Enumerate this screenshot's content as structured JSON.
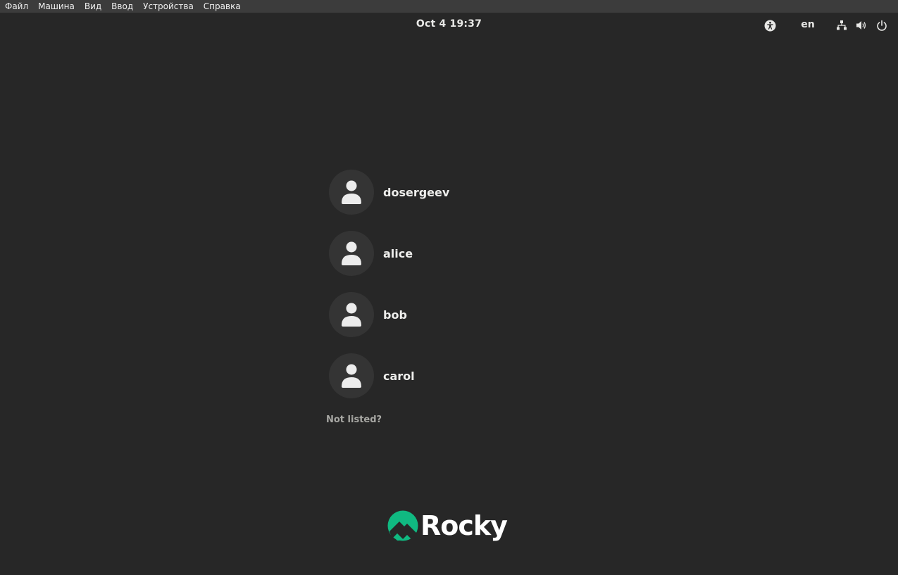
{
  "vm_menu": {
    "items": [
      {
        "label": "Файл"
      },
      {
        "label": "Машина"
      },
      {
        "label": "Вид"
      },
      {
        "label": "Ввод"
      },
      {
        "label": "Устройства"
      },
      {
        "label": "Справка"
      }
    ]
  },
  "topbar": {
    "clock": "Oct 4  19:37",
    "language": "en",
    "icons": [
      "accessibility-icon",
      "network-icon",
      "volume-icon",
      "power-icon"
    ]
  },
  "users": [
    {
      "name": "dosergeev"
    },
    {
      "name": "alice"
    },
    {
      "name": "bob"
    },
    {
      "name": "carol"
    }
  ],
  "not_listed_label": "Not listed?",
  "logo": {
    "text": "Rocky",
    "accent_color": "#10b981"
  },
  "colors": {
    "background": "#272727",
    "avatar_bg": "#343434",
    "text": "#eeeeec"
  }
}
